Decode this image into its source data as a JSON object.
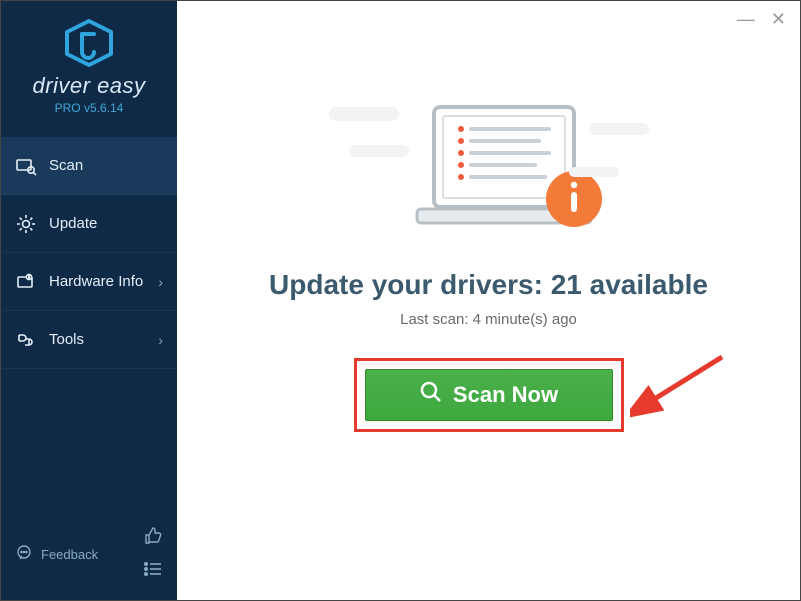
{
  "brand": {
    "name": "driver easy",
    "version": "PRO v5.6.14"
  },
  "sidebar": {
    "items": [
      {
        "label": "Scan"
      },
      {
        "label": "Update"
      },
      {
        "label": "Hardware Info"
      },
      {
        "label": "Tools"
      }
    ],
    "feedback_label": "Feedback"
  },
  "main": {
    "headline_prefix": "Update your drivers: ",
    "available_count": 21,
    "headline_suffix": " available",
    "lastscan_prefix": "Last scan: ",
    "lastscan_value": "4 minute(s) ago",
    "scan_button": "Scan Now"
  },
  "colors": {
    "sidebar_bg": "#0e2a47",
    "accent_blue": "#2fa4dd",
    "scan_green": "#3ea83e",
    "highlight_red": "#e63a2f",
    "info_orange": "#f47a3a"
  }
}
